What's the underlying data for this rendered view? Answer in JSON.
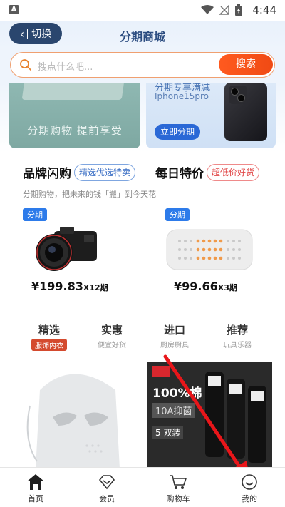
{
  "status_bar": {
    "time": "4:44",
    "app_badge": "A"
  },
  "header": {
    "back_label": "切换",
    "title": "分期商城"
  },
  "search": {
    "placeholder": "搜点什么吧...",
    "button": "搜索"
  },
  "banners": {
    "left": {
      "text": "分期购物 提前享受"
    },
    "right": {
      "title": "分期专享满减",
      "subtitle": "Iphone15pro",
      "cta": "立即分期"
    }
  },
  "flash_sale": {
    "title": "品牌闪购",
    "pill": "精选优选特卖",
    "subtitle": "分期购物，把未来的钱「搬」到今天花",
    "product": {
      "tag": "分期",
      "price": "¥199.83",
      "term": "X12期"
    }
  },
  "daily": {
    "title": "每日特价",
    "pill": "超低价好货",
    "product": {
      "tag": "分期",
      "price": "¥99.66",
      "term": "X3期"
    }
  },
  "tabs": [
    {
      "title": "精选",
      "sub": "服饰内衣"
    },
    {
      "title": "实惠",
      "sub": "便宜好货"
    },
    {
      "title": "进口",
      "sub": "厨房厨具"
    },
    {
      "title": "推荐",
      "sub": "玩具乐器"
    }
  ],
  "bottom_product_right": {
    "line1": "100%棉",
    "line2": "10A抑菌",
    "line3": "5 双装"
  },
  "nav": [
    {
      "label": "首页",
      "icon": "home-icon"
    },
    {
      "label": "会员",
      "icon": "diamond-icon"
    },
    {
      "label": "购物车",
      "icon": "cart-icon"
    },
    {
      "label": "我的",
      "icon": "smiley-icon"
    }
  ],
  "colors": {
    "accent": "#f04a14",
    "brand_blue": "#2a466e",
    "tag_blue": "#2d7bea",
    "annotation_red": "#e8161a"
  }
}
